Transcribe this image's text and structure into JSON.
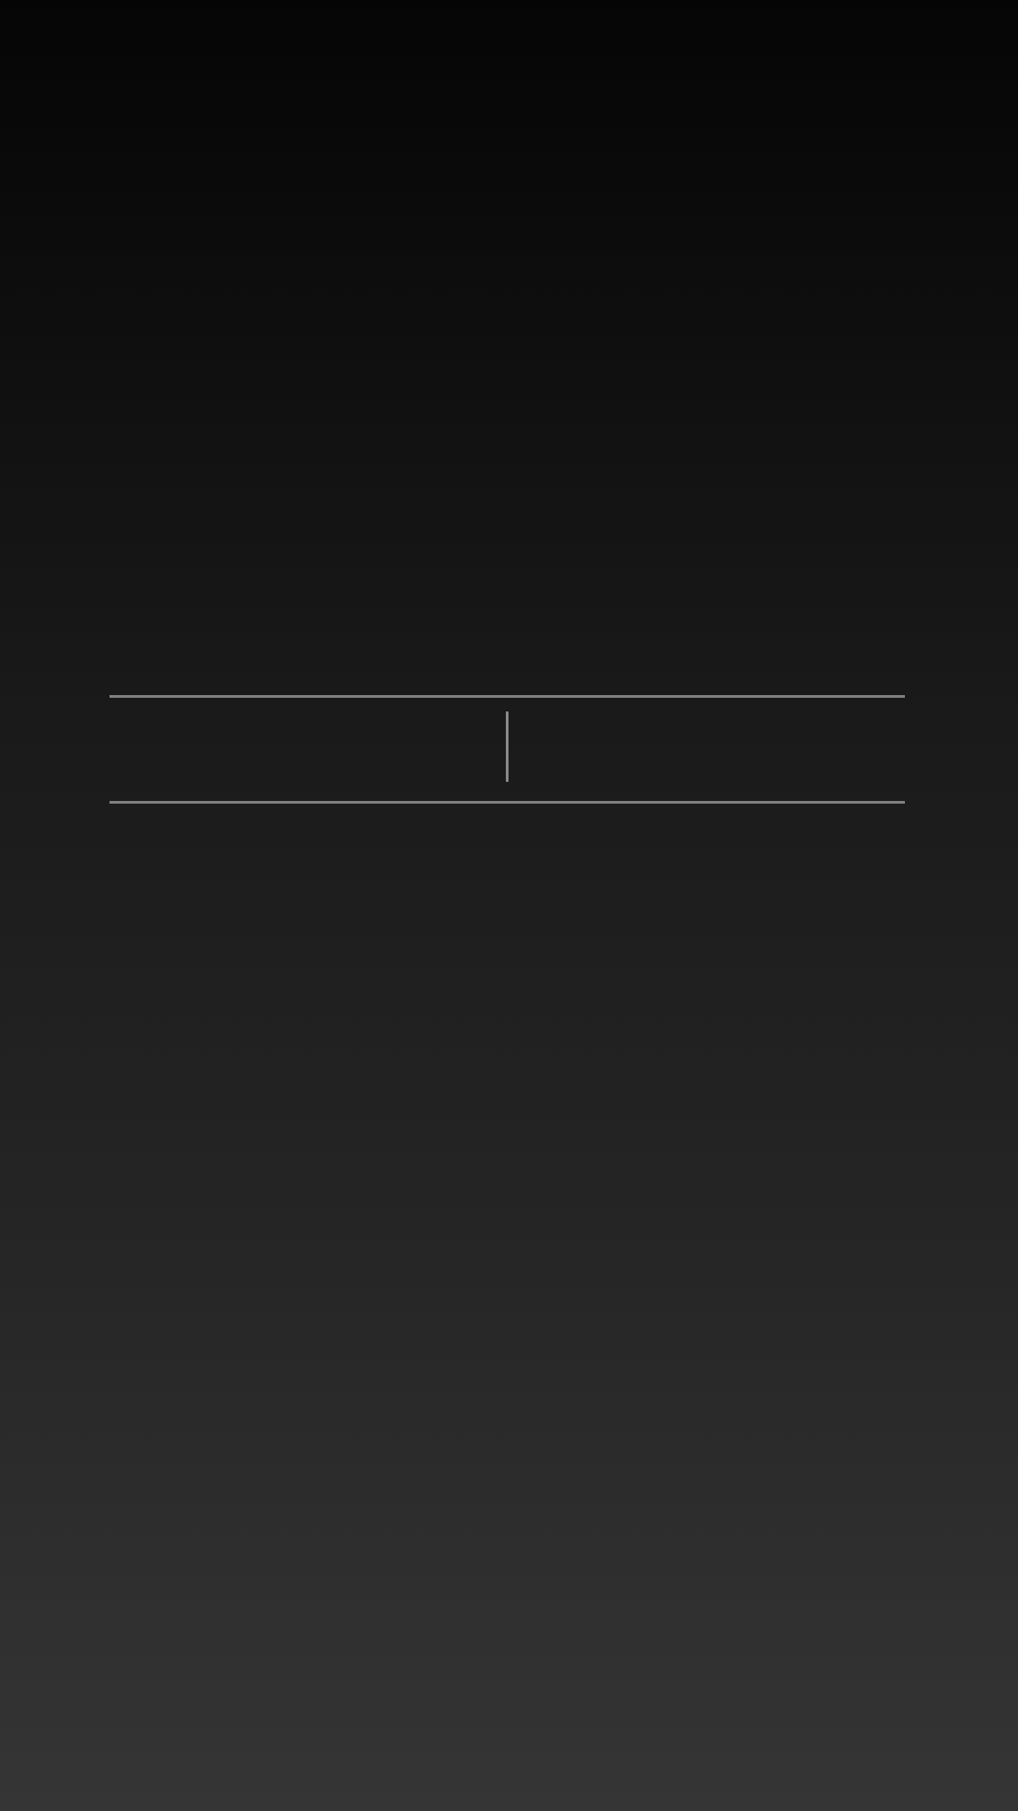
{
  "screen": {
    "background": {
      "top": "#050505",
      "bottom": "#353535"
    }
  },
  "entry_field": {
    "value": "",
    "placeholder": "",
    "border_color": "#808080",
    "caret_color": "#8a8a8a"
  }
}
